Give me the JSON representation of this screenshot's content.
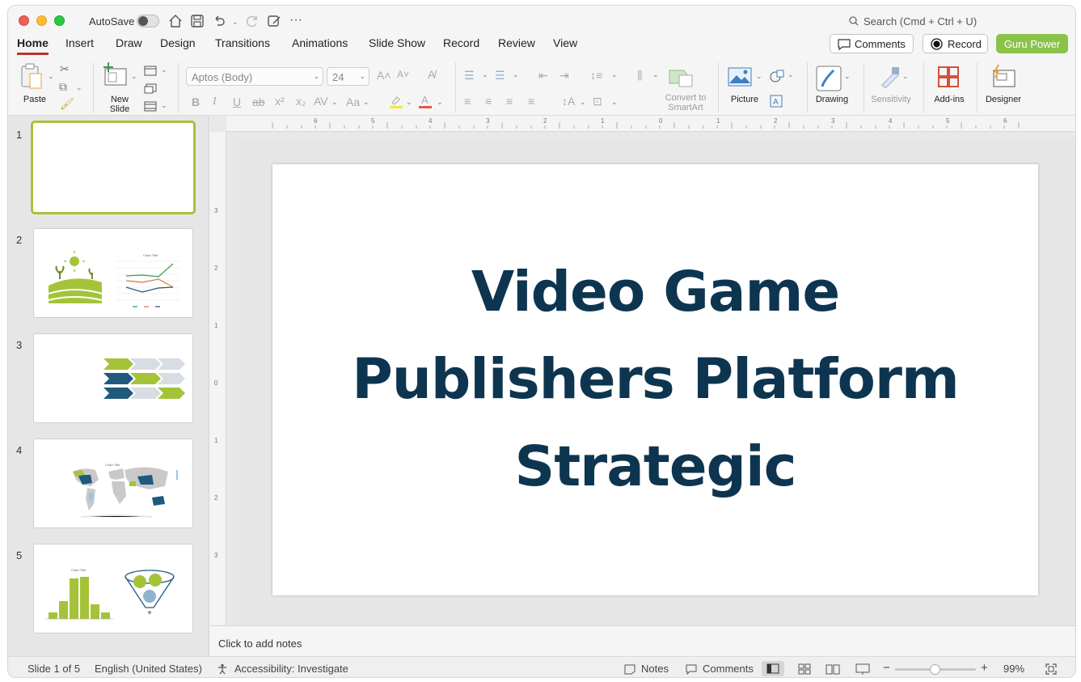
{
  "window": {
    "autosave_label": "AutoSave",
    "search_placeholder": "Search (Cmd + Ctrl + U)"
  },
  "tabs": [
    "Home",
    "Insert",
    "Draw",
    "Design",
    "Transitions",
    "Animations",
    "Slide Show",
    "Record",
    "Review",
    "View"
  ],
  "header_buttons": {
    "comments": "Comments",
    "record": "Record",
    "guru": "Guru Power"
  },
  "ribbon": {
    "paste": "Paste",
    "new_slide": "New Slide",
    "font_name": "Aptos (Body)",
    "font_size": "24",
    "convert_smartart": "Convert to SmartArt",
    "picture": "Picture",
    "drawing": "Drawing",
    "sensitivity": "Sensitivity",
    "addins": "Add-ins",
    "designer": "Designer"
  },
  "slides": [
    {
      "number": "1"
    },
    {
      "number": "2",
      "chart_title": "Chart Title"
    },
    {
      "number": "3"
    },
    {
      "number": "4",
      "chart_title": "Chart Title"
    },
    {
      "number": "5",
      "chart_title": "Chart Title"
    }
  ],
  "ruler": {
    "h": [
      "6",
      "5",
      "4",
      "3",
      "2",
      "1",
      "0",
      "1",
      "2",
      "3",
      "4",
      "5",
      "6"
    ],
    "v": [
      "3",
      "2",
      "1",
      "0",
      "1",
      "2",
      "3"
    ]
  },
  "slide_content": {
    "title_line1": "Video Game",
    "title_line2": "Publishers Platform",
    "title_line3": "Strategic"
  },
  "notes_placeholder": "Click to add notes",
  "status": {
    "slide_position": "Slide 1 of 5",
    "language": "English (United States)",
    "accessibility": "Accessibility: Investigate",
    "notes": "Notes",
    "comments": "Comments",
    "zoom": "99%"
  },
  "colors": {
    "title": "#0d3550",
    "accent_green": "#a4c339",
    "guru_green": "#8bc34a",
    "tab_underline": "#b5372d",
    "navy": "#1f5a7e"
  }
}
